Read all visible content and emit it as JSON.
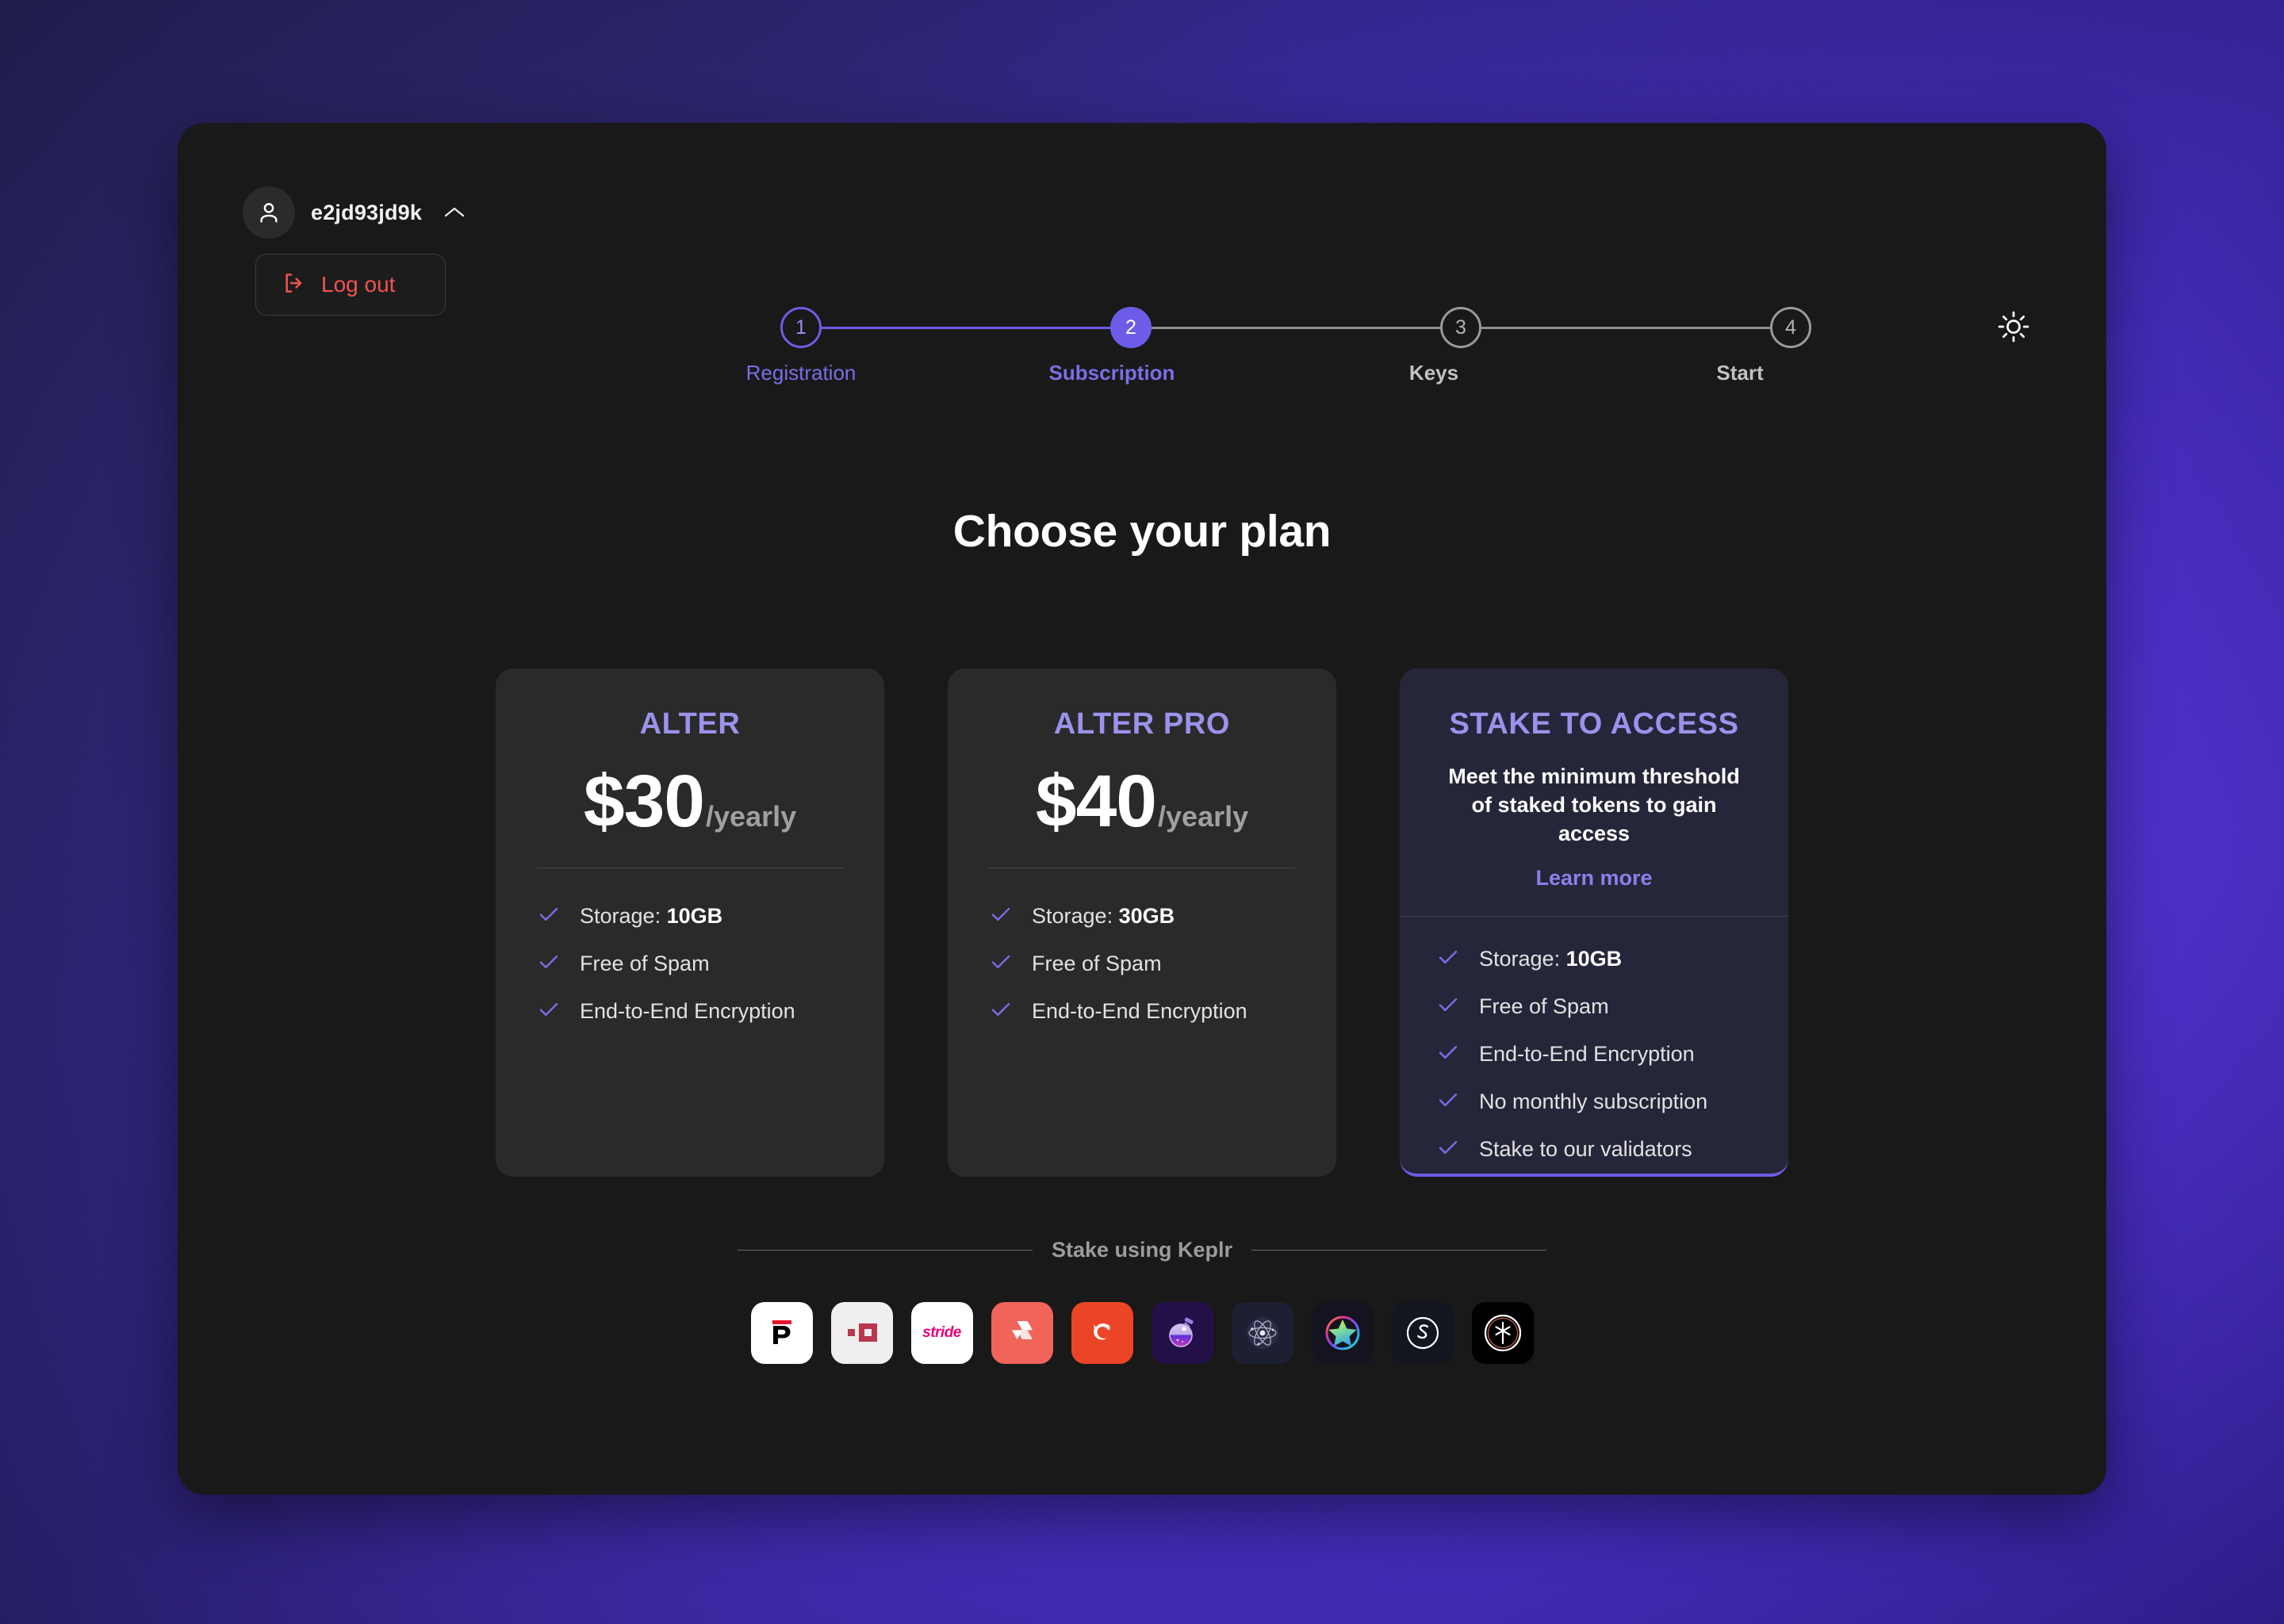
{
  "background": {
    "accent_purple": "#4b30cf",
    "panel_bg": "#191919"
  },
  "header": {
    "username": "e2jd93jd9k",
    "chevron_icon": "chevron-up-icon",
    "avatar_icon": "user-avatar-icon",
    "logout_label": "Log out",
    "logout_icon": "logout-arrow-icon",
    "logout_color": "#f05252",
    "theme_toggle_icon": "sun-icon"
  },
  "stepper": {
    "current_step": 2,
    "steps": [
      {
        "number": "1",
        "label": "Registration",
        "state": "done"
      },
      {
        "number": "2",
        "label": "Subscription",
        "state": "current"
      },
      {
        "number": "3",
        "label": "Keys",
        "state": "pending"
      },
      {
        "number": "4",
        "label": "Start",
        "state": "pending"
      }
    ],
    "accent_color": "#6c5ce7"
  },
  "main": {
    "title": "Choose your plan",
    "plans": [
      {
        "name": "ALTER",
        "price": "$30",
        "period": "/yearly",
        "features": [
          {
            "label": "Storage: ",
            "value": "10GB"
          },
          {
            "label": "Free of Spam",
            "value": ""
          },
          {
            "label": "End-to-End Encryption",
            "value": ""
          }
        ]
      },
      {
        "name": "ALTER PRO",
        "price": "$40",
        "period": "/yearly",
        "features": [
          {
            "label": "Storage: ",
            "value": "30GB"
          },
          {
            "label": "Free of Spam",
            "value": ""
          },
          {
            "label": "End-to-End Encryption",
            "value": ""
          }
        ]
      }
    ],
    "stake_plan": {
      "name": "STAKE TO ACCESS",
      "description": "Meet the minimum threshold of staked tokens to gain access",
      "learn_more": "Learn more",
      "features": [
        {
          "label": "Storage: ",
          "value": "10GB"
        },
        {
          "label": "Free of Spam",
          "value": ""
        },
        {
          "label": "End-to-End Encryption",
          "value": ""
        },
        {
          "label": "No monthly subscription",
          "value": ""
        },
        {
          "label": "Stake to our validators",
          "value": ""
        }
      ],
      "accent_color": "#6c5ce7"
    },
    "check_icon": "check-icon",
    "check_color": "#7b6ee8"
  },
  "keplr": {
    "divider_label": "Stake using Keplr",
    "chains": [
      {
        "name": "persistence",
        "icon": "persistence-logo-icon"
      },
      {
        "name": "secret-network",
        "icon": "secret-network-logo-icon"
      },
      {
        "name": "stride",
        "icon": "stride-logo-icon"
      },
      {
        "name": "akash",
        "icon": "akash-logo-icon"
      },
      {
        "name": "evmos",
        "icon": "evmos-logo-icon"
      },
      {
        "name": "quicksilver",
        "icon": "quicksilver-logo-icon"
      },
      {
        "name": "cosmos",
        "icon": "cosmos-atom-logo-icon"
      },
      {
        "name": "stargaze",
        "icon": "stargaze-logo-icon"
      },
      {
        "name": "sommelier",
        "icon": "sommelier-logo-icon"
      },
      {
        "name": "neutron",
        "icon": "neutron-logo-icon"
      }
    ]
  }
}
